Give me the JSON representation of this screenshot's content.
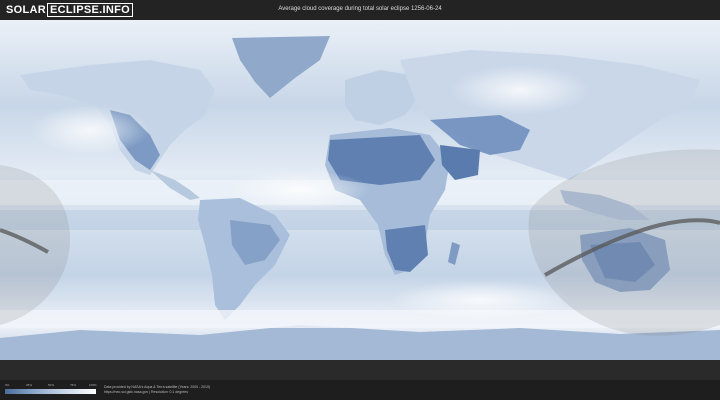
{
  "header": {
    "logo_part1": "SOLAR",
    "logo_part2": "ECLIPSE.INFO",
    "title": "Average cloud coverage during total solar eclipse 1256-06-24"
  },
  "legend": {
    "ticks": [
      "0%",
      "25%",
      "50%",
      "75%",
      "100%"
    ],
    "colors": [
      "#4a6d9c",
      "#8ea9cc",
      "#c9d8ea",
      "#ffffff"
    ]
  },
  "credits": {
    "line1": "Data provided by NASA's Aqua & Terra satellite (Years: 2000 - 2019)",
    "line2": "https://neo.sci.gsfc.nasa.gov  |  Resolution: 0.1 degrees"
  },
  "map": {
    "ocean_color": "#dce6f1",
    "land_dark_color": "#6f8fbc",
    "eclipse_path_color": "#555555"
  }
}
